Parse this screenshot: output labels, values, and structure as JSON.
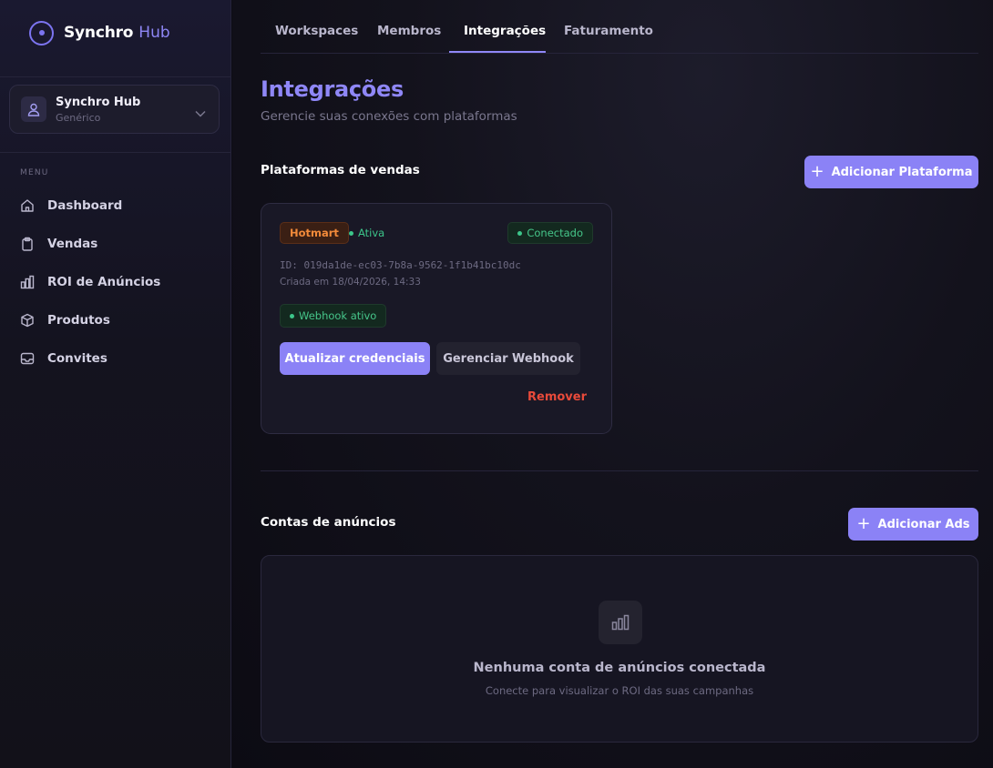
{
  "brand": {
    "name": "Synchro",
    "suffix": "Hub"
  },
  "workspace": {
    "name": "Synchro Hub",
    "subtitle": "Genérico"
  },
  "sidebar": {
    "menu_label": "MENU",
    "items": [
      {
        "label": "Dashboard",
        "icon": "home-icon"
      },
      {
        "label": "Vendas",
        "icon": "clipboard-icon"
      },
      {
        "label": "ROI de Anúncios",
        "icon": "bar-chart-icon"
      },
      {
        "label": "Produtos",
        "icon": "box-icon"
      },
      {
        "label": "Convites",
        "icon": "inbox-icon"
      }
    ]
  },
  "tabs": [
    {
      "label": "Workspaces",
      "active": false
    },
    {
      "label": "Membros",
      "active": false
    },
    {
      "label": "Integrações",
      "active": true
    },
    {
      "label": "Faturamento",
      "active": false
    }
  ],
  "page": {
    "title": "Integrações",
    "subtitle": "Gerencie suas conexões com plataformas"
  },
  "sales": {
    "title": "Plataformas de vendas",
    "add_button": "Adicionar Plataforma",
    "card": {
      "platform": "Hotmart",
      "status": "Ativa",
      "connection": "Conectado",
      "id_text": "ID: 019da1de-ec03-7b8a-9562-1f1b41bc10dc",
      "created": "Criada em 18/04/2026, 14:33",
      "webhook": "Webhook ativo",
      "update_button": "Atualizar credenciais",
      "webhook_button": "Gerenciar Webhook",
      "remove_button": "Remover"
    }
  },
  "ads": {
    "title": "Contas de anúncios",
    "add_button": "Adicionar Ads",
    "empty_title": "Nenhuma conta de anúncios conectada",
    "empty_subtitle": "Conecte para visualizar o ROI das suas campanhas"
  },
  "colors": {
    "accent": "#8b82f6",
    "success": "#3cc58a",
    "danger": "#e84a3a",
    "hotmart": "#f28a3a"
  }
}
